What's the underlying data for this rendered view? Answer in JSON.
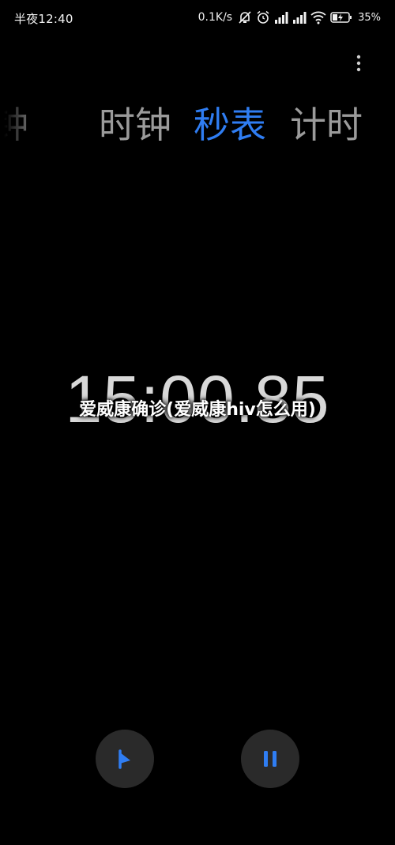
{
  "status_bar": {
    "time": "半夜12:40",
    "network_speed": "0.1K/s",
    "battery": "35%",
    "icons": [
      "notification-muted-icon",
      "alarm-icon",
      "signal-icon",
      "signal-icon",
      "wifi-icon",
      "battery-charging-icon"
    ]
  },
  "tabs": [
    {
      "label": "闹钟",
      "active": false
    },
    {
      "label": "时钟",
      "active": false
    },
    {
      "label": "秒表",
      "active": true
    },
    {
      "label": "计时",
      "active": false
    }
  ],
  "stopwatch": {
    "time": "15:00.85"
  },
  "overlay": {
    "title": "爱威康确诊(爱威康hiv怎么用)"
  },
  "controls": {
    "lap_icon": "flag-icon",
    "pause_icon": "pause-icon"
  },
  "colors": {
    "accent": "#2f7df2",
    "background": "#000000",
    "inactive_tab": "#9b9b9b",
    "button_bg": "#2a2a2a"
  }
}
